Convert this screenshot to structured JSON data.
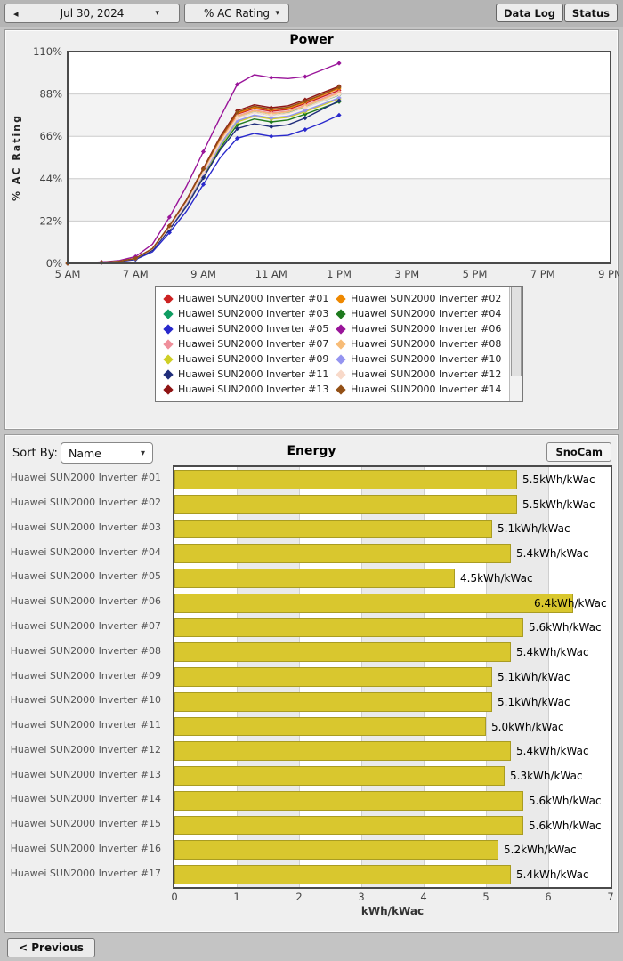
{
  "toolbar": {
    "back_icon": "◂",
    "date_label": "Jul 30, 2024",
    "date_caret": "▾",
    "metric_label": "% AC Rating",
    "metric_caret": "▾",
    "data_log_label": "Data Log",
    "status_label": "Status"
  },
  "energy_header": {
    "sort_by_label": "Sort By:",
    "sort_value": "Name",
    "sort_caret": "▾",
    "snocam_label": "SnoCam"
  },
  "footer": {
    "previous_label": "< Previous"
  },
  "colors": {
    "bar_fill": "#d9c72e",
    "band_gray_power": "#f3f3f3",
    "band_gray_energy": "#eaeaea",
    "gridline": "#cccccc",
    "plot_border": "#4a4a4a"
  },
  "chart_data": [
    {
      "type": "line",
      "title": "Power",
      "ylabel": "% AC Rating",
      "xlim": [
        5,
        21
      ],
      "ylim": [
        0,
        110
      ],
      "yticks": [
        0,
        22,
        44,
        66,
        88,
        110
      ],
      "ytick_labels": [
        "0%",
        "22%",
        "44%",
        "66%",
        "88%",
        "110%"
      ],
      "xtick_hours": [
        5,
        7,
        9,
        11,
        13,
        15,
        17,
        19,
        21
      ],
      "xtick_labels": [
        "5 AM",
        "7 AM",
        "9 AM",
        "11 AM",
        "1 PM",
        "3 PM",
        "5 PM",
        "7 PM",
        "9 PM"
      ],
      "grid": "horizontal",
      "legend_position": "bottom",
      "x": [
        5,
        5.5,
        6,
        6.5,
        7,
        7.5,
        8,
        8.5,
        9,
        9.5,
        10,
        10.5,
        11,
        11.5,
        12,
        12.5,
        13
      ],
      "series": [
        {
          "name": "Huawei SUN2000 Inverter #01",
          "color": "#cc2222",
          "values": [
            0,
            0.2,
            0.5,
            1,
            2.5,
            7.5,
            19,
            32,
            48,
            64.5,
            77.5,
            80.5,
            79,
            80,
            83,
            86.5,
            90
          ]
        },
        {
          "name": "Huawei SUN2000 Inverter #02",
          "color": "#ee8800",
          "values": [
            0,
            0.2,
            0.5,
            1,
            2.6,
            7.6,
            19.3,
            32.5,
            48.7,
            65,
            78,
            81,
            79.7,
            80.7,
            83.7,
            87.3,
            91
          ]
        },
        {
          "name": "Huawei SUN2000 Inverter #03",
          "color": "#0f9d62",
          "values": [
            0,
            0.2,
            0.5,
            1,
            2.4,
            7.3,
            18.5,
            31,
            47,
            62.5,
            75.5,
            78.5,
            77,
            78,
            81,
            84.3,
            87.5
          ]
        },
        {
          "name": "Huawei SUN2000 Inverter #04",
          "color": "#1e7a1e",
          "values": [
            0,
            0.2,
            0.5,
            0.9,
            2.3,
            7,
            17.8,
            30,
            45,
            60,
            72,
            75,
            73.5,
            74.5,
            77.5,
            80.7,
            84
          ]
        },
        {
          "name": "Huawei SUN2000 Inverter #05",
          "color": "#2929cc",
          "values": [
            0,
            0.2,
            0.4,
            0.8,
            2,
            6,
            16,
            27,
            41,
            55,
            65,
            67.5,
            66,
            66.5,
            69.5,
            73,
            77
          ]
        },
        {
          "name": "Huawei SUN2000 Inverter #06",
          "color": "#991499",
          "values": [
            0,
            0.3,
            0.7,
            1.4,
            3.5,
            10,
            24,
            40,
            58,
            76,
            93,
            98,
            96.5,
            96,
            97,
            100.5,
            104
          ]
        },
        {
          "name": "Huawei SUN2000 Inverter #07",
          "color": "#ef8f9b",
          "values": [
            0,
            0.2,
            0.5,
            1,
            2.5,
            7.4,
            18.9,
            31.8,
            47.8,
            63.7,
            76.6,
            79.6,
            78.1,
            79.1,
            82.1,
            85.6,
            89
          ]
        },
        {
          "name": "Huawei SUN2000 Inverter #08",
          "color": "#f7bc77",
          "values": [
            0,
            0.2,
            0.5,
            1,
            2.5,
            7.4,
            18.8,
            31.7,
            47.5,
            63.4,
            76.2,
            79.2,
            77.7,
            78.7,
            81.7,
            85.1,
            88.5
          ]
        },
        {
          "name": "Huawei SUN2000 Inverter #09",
          "color": "#cfcf26",
          "values": [
            0,
            0.2,
            0.5,
            1,
            2.4,
            7.2,
            18.1,
            30.6,
            45.8,
            61.1,
            73.5,
            76.4,
            75,
            75.9,
            78.8,
            82.1,
            85.5
          ]
        },
        {
          "name": "Huawei SUN2000 Inverter #10",
          "color": "#9494f0",
          "values": [
            0,
            0.2,
            0.5,
            1,
            2.4,
            7.2,
            18.3,
            30.8,
            46.2,
            61.6,
            74.1,
            77,
            75.5,
            76.5,
            79.4,
            82.7,
            86
          ]
        },
        {
          "name": "Huawei SUN2000 Inverter #11",
          "color": "#1f2d7a",
          "values": [
            0,
            0.2,
            0.5,
            0.9,
            2.2,
            6.8,
            17.5,
            29.5,
            44.5,
            59,
            70,
            72.5,
            71,
            72,
            75.5,
            80,
            84.5
          ]
        },
        {
          "name": "Huawei SUN2000 Inverter #12",
          "color": "#f8d9c9",
          "values": [
            0,
            0.2,
            0.5,
            1,
            2.5,
            7.4,
            18.6,
            31.4,
            47,
            62.7,
            75.5,
            78.4,
            77,
            77.9,
            80.9,
            84.3,
            87.7
          ]
        },
        {
          "name": "Huawei SUN2000 Inverter #13",
          "color": "#8f1414",
          "values": [
            0,
            0.2,
            0.5,
            1,
            2.6,
            7.7,
            19.6,
            33,
            49.4,
            65.9,
            79.3,
            82.4,
            80.9,
            81.9,
            85,
            88.6,
            92
          ]
        },
        {
          "name": "Huawei SUN2000 Inverter #14",
          "color": "#935016",
          "values": [
            0,
            0.2,
            0.5,
            1,
            2.6,
            7.7,
            19.4,
            32.6,
            49,
            65.3,
            78.5,
            81.6,
            80.1,
            81.1,
            84.2,
            87.7,
            91.5
          ]
        }
      ]
    },
    {
      "type": "bar",
      "orientation": "horizontal",
      "title": "Energy",
      "xlabel": "kWh/kWac",
      "xlim": [
        0,
        7
      ],
      "xticks": [
        0,
        1,
        2,
        3,
        4,
        5,
        6,
        7
      ],
      "grid": "vertical",
      "categories": [
        "Huawei SUN2000 Inverter #01",
        "Huawei SUN2000 Inverter #02",
        "Huawei SUN2000 Inverter #03",
        "Huawei SUN2000 Inverter #04",
        "Huawei SUN2000 Inverter #05",
        "Huawei SUN2000 Inverter #06",
        "Huawei SUN2000 Inverter #07",
        "Huawei SUN2000 Inverter #08",
        "Huawei SUN2000 Inverter #09",
        "Huawei SUN2000 Inverter #10",
        "Huawei SUN2000 Inverter #11",
        "Huawei SUN2000 Inverter #12",
        "Huawei SUN2000 Inverter #13",
        "Huawei SUN2000 Inverter #14",
        "Huawei SUN2000 Inverter #15",
        "Huawei SUN2000 Inverter #16",
        "Huawei SUN2000 Inverter #17"
      ],
      "values": [
        5.5,
        5.5,
        5.1,
        5.4,
        4.5,
        6.4,
        5.6,
        5.4,
        5.1,
        5.1,
        5.0,
        5.4,
        5.3,
        5.6,
        5.6,
        5.2,
        5.4
      ],
      "value_labels": [
        "5.5kWh/kWac",
        "5.5kWh/kWac",
        "5.1kWh/kWac",
        "5.4kWh/kWac",
        "4.5kWh/kWac",
        "6.4kWh/kWac",
        "5.6kWh/kWac",
        "5.4kWh/kWac",
        "5.1kWh/kWac",
        "5.1kWh/kWac",
        "5.0kWh/kWac",
        "5.4kWh/kWac",
        "5.3kWh/kWac",
        "5.6kWh/kWac",
        "5.6kWh/kWac",
        "5.2kWh/kWac",
        "5.4kWh/kWac"
      ]
    }
  ]
}
